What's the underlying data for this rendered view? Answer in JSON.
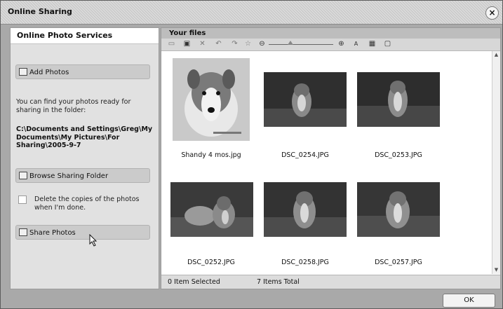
{
  "window": {
    "title": "Online Sharing",
    "close_glyph": "×"
  },
  "left": {
    "header": "Online Photo Services",
    "add_photos": "Add Photos",
    "info": "You can find your photos ready for sharing in the folder:",
    "path": "C:\\Documents and Settings\\Greg\\My Documents\\My Pictures\\For Sharing\\2005-9-7",
    "browse": "Browse Sharing Folder",
    "delete_label": "Delete the copies of the photos when I'm done.",
    "share": "Share Photos"
  },
  "right": {
    "header": "Your files"
  },
  "photos": [
    {
      "name": "Shandy 4 mos.jpg"
    },
    {
      "name": "DSC_0254.JPG"
    },
    {
      "name": "DSC_0253.JPG"
    },
    {
      "name": "DSC_0252.JPG"
    },
    {
      "name": "DSC_0258.JPG"
    },
    {
      "name": "DSC_0257.JPG"
    }
  ],
  "status": {
    "selected": "0 Item Selected",
    "total": "7 Items Total"
  },
  "ok": "OK",
  "icons": [
    "monitor-icon",
    "select-photo-icon",
    "delete-icon",
    "rotate-left-icon",
    "rotate-right-icon",
    "star-icon",
    "zoom-out-icon",
    "zoom-in-icon",
    "rename-icon",
    "thumbnail-view-icon",
    "preview-icon",
    "scroll-up-icon",
    "scroll-down-icon"
  ]
}
